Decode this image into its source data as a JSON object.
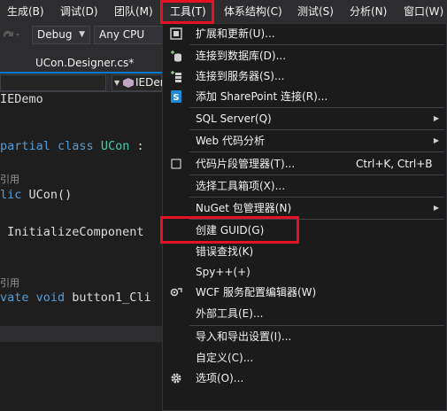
{
  "menubar": {
    "items": [
      "生成(B)",
      "调试(D)",
      "团队(M)",
      "工具(T)",
      "体系结构(C)",
      "测试(S)",
      "分析(N)",
      "窗口(W)"
    ]
  },
  "toolbar": {
    "config": "Debug",
    "platform": "Any CPU"
  },
  "tab": {
    "title": "UCon.Designer.cs*"
  },
  "navbar": {
    "member": "IEDem"
  },
  "editor": {
    "lines": {
      "l1": "IEDemo",
      "l2_kw": "partial class",
      "l2_ty": "UCon",
      "l2_rest": " :",
      "ref1": "引用",
      "l3_kw": "lic",
      "l3_rest": " UCon()",
      "l4": " InitializeComponent",
      "ref2": "引用",
      "l5_kw": "vate void",
      "l5_rest": " button1_Cli"
    }
  },
  "tools_menu": {
    "items": {
      "extensions": "扩展和更新(U)...",
      "connect_db": "连接到数据库(D)...",
      "connect_server": "连接到服务器(S)...",
      "sharepoint": "添加 SharePoint 连接(R)...",
      "sql_server": "SQL Server(Q)",
      "web_analysis": "Web 代码分析",
      "snippets": "代码片段管理器(T)...",
      "snippets_shortcut": "Ctrl+K, Ctrl+B",
      "choose_toolbox": "选择工具箱项(X)...",
      "nuget": "NuGet 包管理器(N)",
      "create_guid": "创建 GUID(G)",
      "error_lookup": "错误查找(K)",
      "spy": "Spy++(+)",
      "wcf_editor": "WCF 服务配置编辑器(W)",
      "external_tools": "外部工具(E)...",
      "import_export": "导入和导出设置(I)...",
      "customize": "自定义(C)...",
      "options": "选项(O)..."
    }
  },
  "colors": {
    "highlight_box": "#e81123",
    "menu_bg": "#1b1b1c",
    "accent": "#007acc"
  }
}
